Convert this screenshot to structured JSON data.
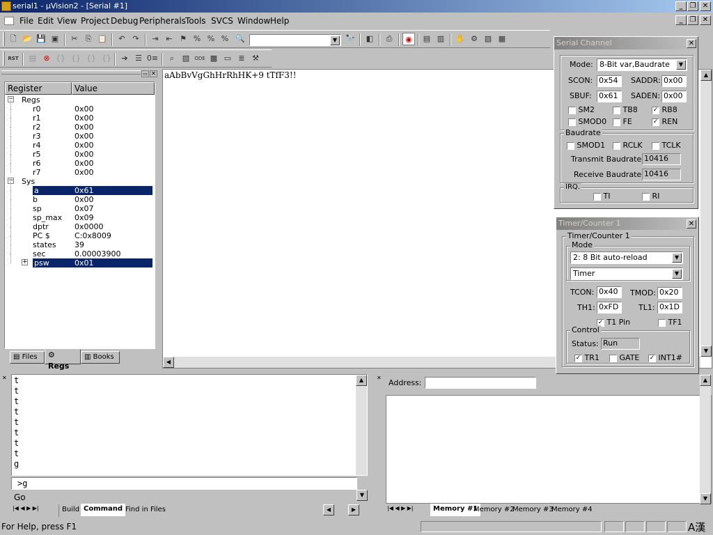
{
  "window": {
    "title": "serial1  - µVision2 - [Serial #1]"
  },
  "menu": [
    {
      "label": "File"
    },
    {
      "label": "Edit"
    },
    {
      "label": "View"
    },
    {
      "label": "Project"
    },
    {
      "label": "Debug"
    },
    {
      "label": "Peripherals"
    },
    {
      "label": "Tools"
    },
    {
      "label": "SVCS"
    },
    {
      "label": "Window"
    },
    {
      "label": "Help"
    }
  ],
  "toolbar": {
    "find_combo_value": ""
  },
  "register_panel": {
    "col_register": "Register",
    "col_value": "Value",
    "regs_group": "Regs",
    "regs": [
      {
        "name": "r0",
        "value": "0x00"
      },
      {
        "name": "r1",
        "value": "0x00"
      },
      {
        "name": "r2",
        "value": "0x00"
      },
      {
        "name": "r3",
        "value": "0x00"
      },
      {
        "name": "r4",
        "value": "0x00"
      },
      {
        "name": "r5",
        "value": "0x00"
      },
      {
        "name": "r6",
        "value": "0x00"
      },
      {
        "name": "r7",
        "value": "0x00"
      }
    ],
    "sys_group": "Sys",
    "sys": [
      {
        "name": "a",
        "value": "0x61"
      },
      {
        "name": "b",
        "value": "0x00"
      },
      {
        "name": "sp",
        "value": "0x07"
      },
      {
        "name": "sp_max",
        "value": "0x09"
      },
      {
        "name": "dptr",
        "value": "0x0000"
      },
      {
        "name": "PC  $",
        "value": "C:0x8009"
      },
      {
        "name": "states",
        "value": "39"
      },
      {
        "name": "sec",
        "value": "0.00003900"
      },
      {
        "name": "psw",
        "value": "0x01"
      }
    ],
    "tabs": [
      {
        "label": "Files"
      },
      {
        "label": "Regs"
      },
      {
        "label": "Books"
      }
    ]
  },
  "serial_window": {
    "text": "aAbBvVgGhHrRhHK+9 tTfF3!!"
  },
  "serial_channel": {
    "title": "Serial Channel",
    "mode_label": "Mode:",
    "mode_value": "8-Bit var,Baudrate",
    "scon_label": "SCON:",
    "scon_value": "0x54",
    "saddr_label": "SADDR:",
    "saddr_value": "0x00",
    "sbuf_label": "SBUF:",
    "sbuf_value": "0x61",
    "saden_label": "SADEN:",
    "saden_value": "0x00",
    "checks": [
      {
        "label": "SM2",
        "checked": false
      },
      {
        "label": "TB8",
        "checked": false
      },
      {
        "label": "RB8",
        "checked": true
      },
      {
        "label": "SMOD0",
        "checked": false
      },
      {
        "label": "FE",
        "checked": false
      },
      {
        "label": "REN",
        "checked": true
      }
    ],
    "baudrate_group": "Baudrate",
    "baud_checks": [
      {
        "label": "SMOD1"
      },
      {
        "label": "RCLK"
      },
      {
        "label": "TCLK"
      }
    ],
    "tx_baud_label": "Transmit Baudrate:",
    "tx_baud_value": "10416",
    "rx_baud_label": "Receive Baudrate:",
    "rx_baud_value": "10416",
    "irq_group": "IRQ.",
    "irq_checks": [
      {
        "label": "TI"
      },
      {
        "label": "RI"
      }
    ]
  },
  "timer_counter": {
    "title": "Timer/Counter 1",
    "group": "Timer/Counter 1",
    "mode_group": "Mode",
    "mode_value": "2: 8 Bit auto-reload",
    "type_value": "Timer",
    "tcon_label": "TCON:",
    "tcon_value": "0x40",
    "tmod_label": "TMOD:",
    "tmod_value": "0x20",
    "th1_label": "TH1:",
    "th1_value": "0xFD",
    "tl1_label": "TL1:",
    "tl1_value": "0x1D",
    "t1pin_label": "T1 Pin",
    "tf1_label": "TF1",
    "control_group": "Control",
    "status_label": "Status:",
    "status_value": "Run",
    "tr1_label": "TR1",
    "gate_label": "GATE",
    "int1_label": "INT1#"
  },
  "output": {
    "lines": [
      "t",
      "t",
      "t",
      "t",
      "t",
      "t",
      "t",
      "t",
      "g"
    ],
    "command_echo": ">g",
    "command_input": "Go",
    "tabs": [
      {
        "label": "Build"
      },
      {
        "label": "Command"
      },
      {
        "label": "Find in Files"
      }
    ]
  },
  "memory": {
    "address_label": "Address:",
    "address_value": "",
    "tabs": [
      {
        "label": "Memory #1"
      },
      {
        "label": "Memory #2"
      },
      {
        "label": "Memory #3"
      },
      {
        "label": "Memory #4"
      }
    ]
  },
  "status": {
    "text": "For Help, press F1",
    "ime": "A漢"
  }
}
